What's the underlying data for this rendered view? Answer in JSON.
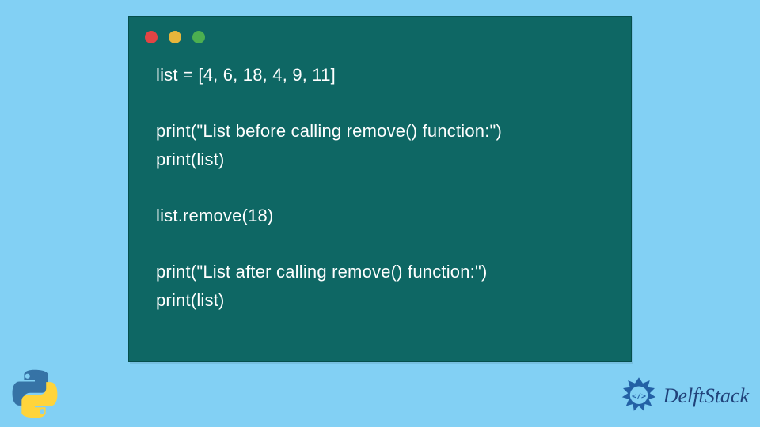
{
  "colors": {
    "background": "#82D0F4",
    "window_bg": "#0E6764",
    "text": "#FFFFFF",
    "dot_red": "#E34444",
    "dot_yellow": "#E8B63B",
    "dot_green": "#4CAF50",
    "brand_text": "#20427A"
  },
  "code": {
    "lines": [
      "list = [4, 6, 18, 4, 9, 11]",
      "",
      "print(\"List before calling remove() function:\")",
      "print(list)",
      "",
      "list.remove(18)",
      "",
      "print(\"List after calling remove() function:\")",
      "print(list)"
    ]
  },
  "icons": {
    "python": "python-logo",
    "delft": "delftstack-logo"
  },
  "brand": {
    "name": "DelftStack"
  }
}
